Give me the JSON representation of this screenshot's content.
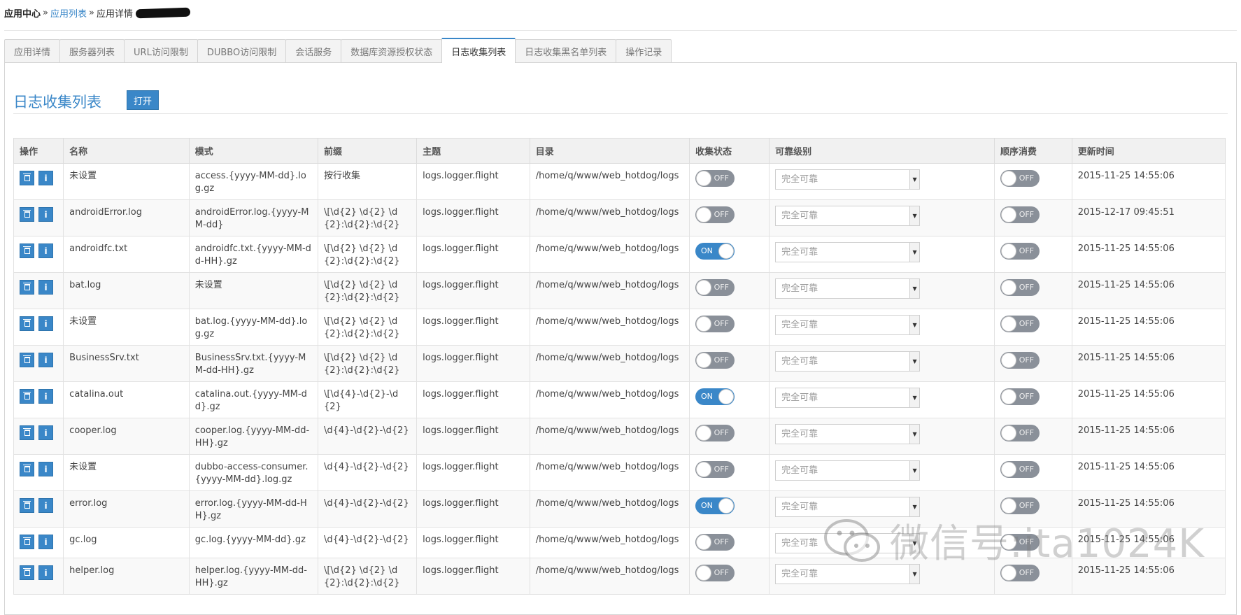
{
  "breadcrumb": {
    "root": "应用中心",
    "sep": "»",
    "list": "应用列表",
    "detail": "应用详情"
  },
  "tabs": [
    {
      "label": "应用详情",
      "active": false
    },
    {
      "label": "服务器列表",
      "active": false
    },
    {
      "label": "URL访问限制",
      "active": false
    },
    {
      "label": "DUBBO访问限制",
      "active": false
    },
    {
      "label": "会话服务",
      "active": false
    },
    {
      "label": "数据库资源授权状态",
      "active": false
    },
    {
      "label": "日志收集列表",
      "active": true
    },
    {
      "label": "日志收集黑名单列表",
      "active": false
    },
    {
      "label": "操作记录",
      "active": false
    }
  ],
  "section": {
    "title": "日志收集列表",
    "open_label": "打开"
  },
  "table": {
    "headers": [
      "操作",
      "名称",
      "模式",
      "前缀",
      "主题",
      "目录",
      "收集状态",
      "可靠级别",
      "顺序消费",
      "更新时间"
    ],
    "rows": [
      {
        "name": "未设置",
        "pattern": "access.{yyyy-MM-dd}.log.gz",
        "prefix": "按行收集",
        "topic": "logs.logger.flight",
        "dir": "/home/q/www/web_hotdog/logs",
        "collect": "OFF",
        "level": "完全可靠",
        "order": "OFF",
        "updated": "2015-11-25 14:55:06"
      },
      {
        "name": "androidError.log",
        "pattern": "androidError.log.{yyyy-MM-dd}",
        "prefix": "\\[\\d{2} \\d{2} \\d{2}:\\d{2}:\\d{2}",
        "topic": "logs.logger.flight",
        "dir": "/home/q/www/web_hotdog/logs",
        "collect": "OFF",
        "level": "完全可靠",
        "order": "OFF",
        "updated": "2015-12-17 09:45:51"
      },
      {
        "name": "androidfc.txt",
        "pattern": "androidfc.txt.{yyyy-MM-dd-HH}.gz",
        "prefix": "\\[\\d{2} \\d{2} \\d{2}:\\d{2}:\\d{2}",
        "topic": "logs.logger.flight",
        "dir": "/home/q/www/web_hotdog/logs",
        "collect": "ON",
        "level": "完全可靠",
        "order": "OFF",
        "updated": "2015-11-25 14:55:06"
      },
      {
        "name": "bat.log",
        "pattern": "未设置",
        "prefix": "\\[\\d{2} \\d{2} \\d{2}:\\d{2}:\\d{2}",
        "topic": "logs.logger.flight",
        "dir": "/home/q/www/web_hotdog/logs",
        "collect": "OFF",
        "level": "完全可靠",
        "order": "OFF",
        "updated": "2015-11-25 14:55:06"
      },
      {
        "name": "未设置",
        "pattern": "bat.log.{yyyy-MM-dd}.log.gz",
        "prefix": "\\[\\d{2} \\d{2} \\d{2}:\\d{2}:\\d{2}",
        "topic": "logs.logger.flight",
        "dir": "/home/q/www/web_hotdog/logs",
        "collect": "OFF",
        "level": "完全可靠",
        "order": "OFF",
        "updated": "2015-11-25 14:55:06"
      },
      {
        "name": "BusinessSrv.txt",
        "pattern": "BusinessSrv.txt.{yyyy-MM-dd-HH}.gz",
        "prefix": "\\[\\d{2} \\d{2} \\d{2}:\\d{2}:\\d{2}",
        "topic": "logs.logger.flight",
        "dir": "/home/q/www/web_hotdog/logs",
        "collect": "OFF",
        "level": "完全可靠",
        "order": "OFF",
        "updated": "2015-11-25 14:55:06"
      },
      {
        "name": "catalina.out",
        "pattern": "catalina.out.{yyyy-MM-dd}.gz",
        "prefix": "\\[\\d{4}-\\d{2}-\\d{2}",
        "topic": "logs.logger.flight",
        "dir": "/home/q/www/web_hotdog/logs",
        "collect": "ON",
        "level": "完全可靠",
        "order": "OFF",
        "updated": "2015-11-25 14:55:06"
      },
      {
        "name": "cooper.log",
        "pattern": "cooper.log.{yyyy-MM-dd-HH}.gz",
        "prefix": "\\d{4}-\\d{2}-\\d{2}",
        "topic": "logs.logger.flight",
        "dir": "/home/q/www/web_hotdog/logs",
        "collect": "OFF",
        "level": "完全可靠",
        "order": "OFF",
        "updated": "2015-11-25 14:55:06"
      },
      {
        "name": "未设置",
        "pattern": "dubbo-access-consumer.{yyyy-MM-dd}.log.gz",
        "prefix": "\\d{4}-\\d{2}-\\d{2}",
        "topic": "logs.logger.flight",
        "dir": "/home/q/www/web_hotdog/logs",
        "collect": "OFF",
        "level": "完全可靠",
        "order": "OFF",
        "updated": "2015-11-25 14:55:06"
      },
      {
        "name": "error.log",
        "pattern": "error.log.{yyyy-MM-dd-HH}.gz",
        "prefix": "\\d{4}-\\d{2}-\\d{2}",
        "topic": "logs.logger.flight",
        "dir": "/home/q/www/web_hotdog/logs",
        "collect": "ON",
        "level": "完全可靠",
        "order": "OFF",
        "updated": "2015-11-25 14:55:06"
      },
      {
        "name": "gc.log",
        "pattern": "gc.log.{yyyy-MM-dd}.gz",
        "prefix": "\\d{4}-\\d{2}-\\d{2}",
        "topic": "logs.logger.flight",
        "dir": "/home/q/www/web_hotdog/logs",
        "collect": "OFF",
        "level": "完全可靠",
        "order": "OFF",
        "updated": "2015-11-25 14:55:06"
      },
      {
        "name": "helper.log",
        "pattern": "helper.log.{yyyy-MM-dd-HH}.gz",
        "prefix": "\\[\\d{2} \\d{2} \\d{2}:\\d{2}:\\d{2}",
        "topic": "logs.logger.flight",
        "dir": "/home/q/www/web_hotdog/logs",
        "collect": "OFF",
        "level": "完全可靠",
        "order": "OFF",
        "updated": "2015-11-25 14:55:06"
      }
    ]
  },
  "icons": {
    "delete": "trash-icon",
    "info": "info-icon",
    "select_arrow": "chevron-down-icon",
    "watermark": "wechat-icon"
  },
  "watermark": {
    "text": "微信号:ita1024K"
  },
  "colors": {
    "accent": "#3a87c8",
    "toggle_off": "#8a9099",
    "header_bg": "#f1f1f1"
  }
}
